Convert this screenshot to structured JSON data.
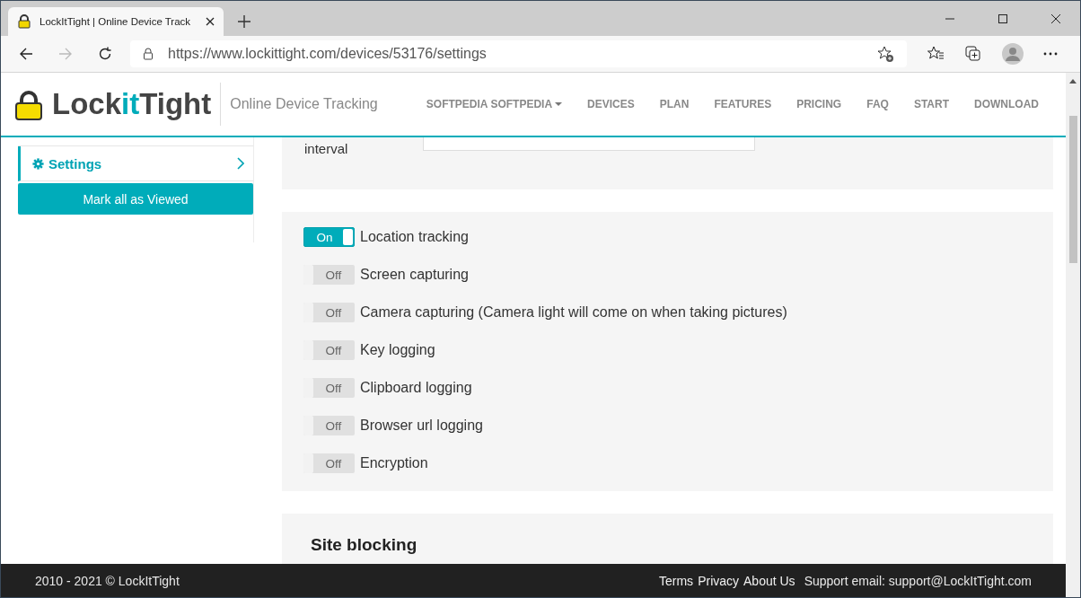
{
  "browser": {
    "tab_title": "LockItTight | Online Device Track",
    "url": "https://www.lockittight.com/devices/53176/settings"
  },
  "header": {
    "logo": [
      {
        "text": "Lock",
        "accent": false
      },
      {
        "text": "it",
        "accent": true
      },
      {
        "text": "Tight",
        "accent": false
      }
    ],
    "tagline": "Online Device Tracking",
    "nav": [
      {
        "label": "SOFTPEDIA SOFTPEDIA",
        "dropdown": true
      },
      {
        "label": "DEVICES",
        "dropdown": false
      },
      {
        "label": "PLAN",
        "dropdown": false
      },
      {
        "label": "FEATURES",
        "dropdown": false
      },
      {
        "label": "PRICING",
        "dropdown": false
      },
      {
        "label": "FAQ",
        "dropdown": false
      },
      {
        "label": "START",
        "dropdown": false
      },
      {
        "label": "DOWNLOAD",
        "dropdown": false
      }
    ]
  },
  "sidebar": {
    "items": [
      {
        "label": "Settings",
        "selected": true
      }
    ],
    "button": "Mark all as Viewed"
  },
  "interval": {
    "label": "interval"
  },
  "toggles": [
    {
      "label": "Location tracking",
      "on": true,
      "state": "On"
    },
    {
      "label": "Screen capturing",
      "on": false,
      "state": "Off"
    },
    {
      "label": "Camera capturing (Camera light will come on when taking pictures)",
      "on": false,
      "state": "Off"
    },
    {
      "label": "Key logging",
      "on": false,
      "state": "Off"
    },
    {
      "label": "Clipboard logging",
      "on": false,
      "state": "Off"
    },
    {
      "label": "Browser url logging",
      "on": false,
      "state": "Off"
    },
    {
      "label": "Encryption",
      "on": false,
      "state": "Off"
    }
  ],
  "site_blocking": {
    "heading": "Site blocking"
  },
  "footer": {
    "copyright": "2010 - 2021 © LockItTight",
    "links": [
      "Terms",
      "Privacy",
      "About Us"
    ],
    "support": "Support email: support@LockItTight.com"
  }
}
